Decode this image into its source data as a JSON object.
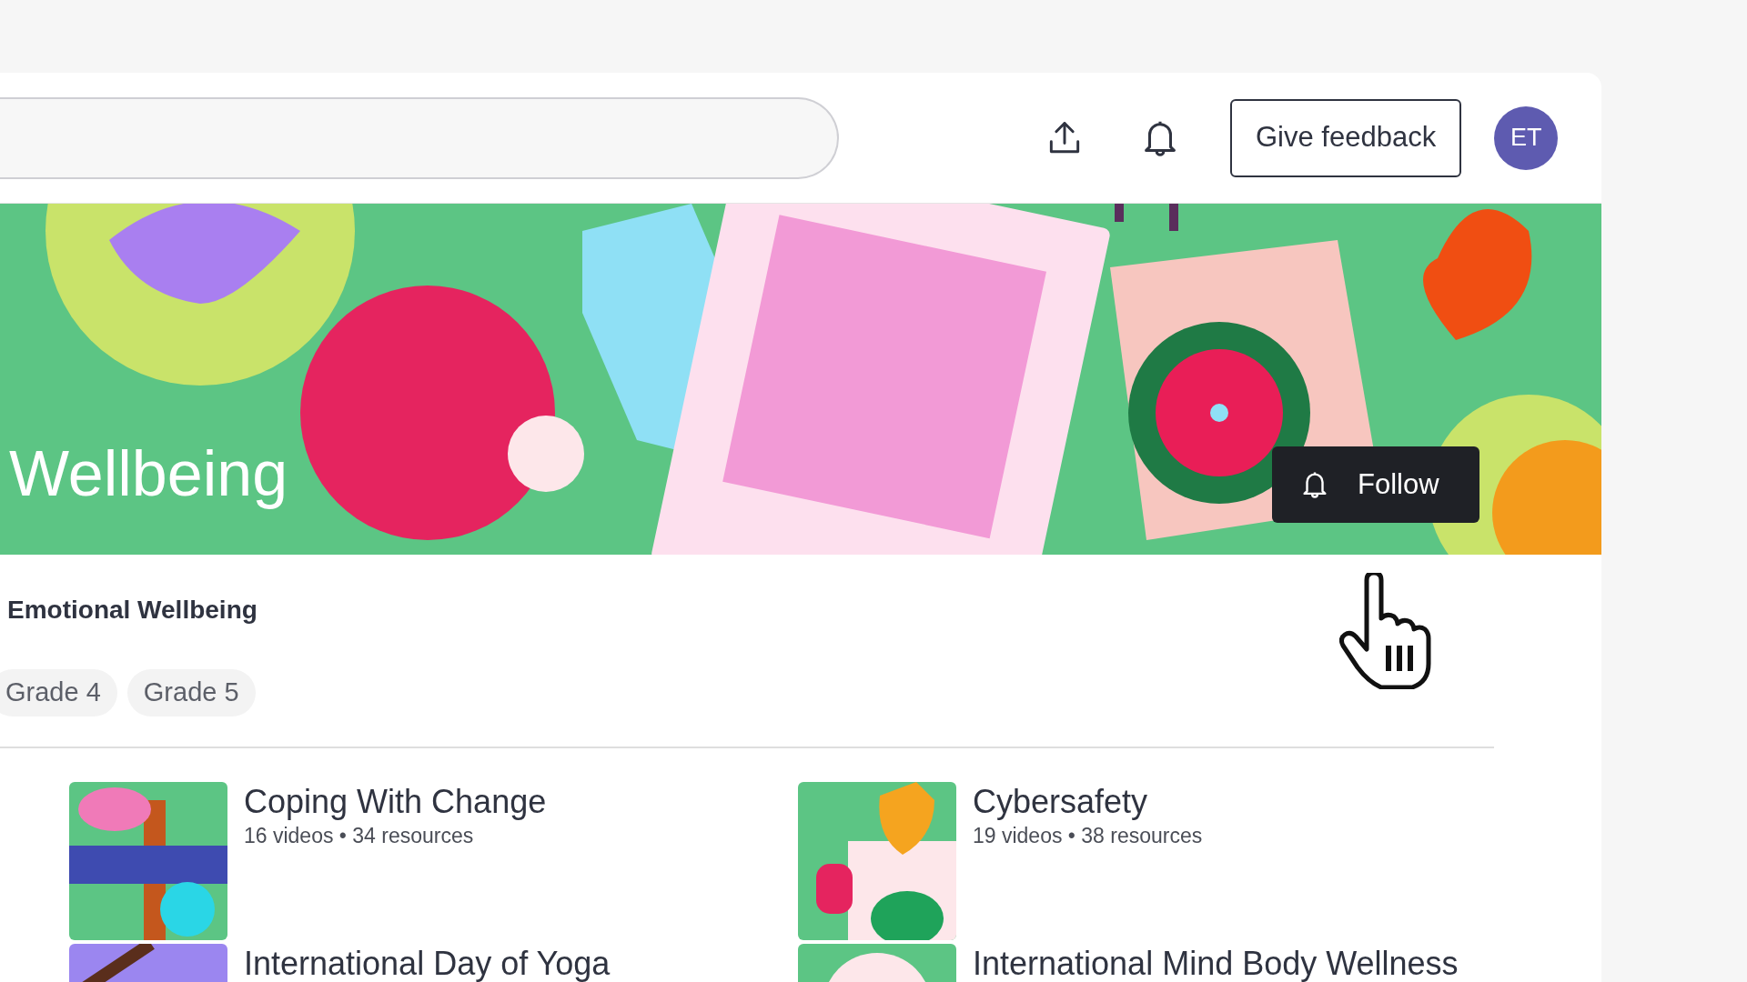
{
  "header": {
    "avatar": "ET",
    "feedback_button": "Give feedback"
  },
  "banner": {
    "title": "Wellbeing",
    "follow_button": "Follow"
  },
  "section": {
    "title": "Emotional Wellbeing",
    "chips": [
      "Grade 4",
      "Grade 5"
    ]
  },
  "collections": [
    {
      "title": "Coping With Change",
      "meta": "16 videos • 34 resources",
      "kind": "change"
    },
    {
      "title": "Cybersafety",
      "meta": "19 videos • 38 resources",
      "kind": "shield"
    },
    {
      "title": "International Day of Yoga",
      "kind": "yoga"
    },
    {
      "title": "International Mind Body Wellness",
      "kind": "mind"
    }
  ]
}
